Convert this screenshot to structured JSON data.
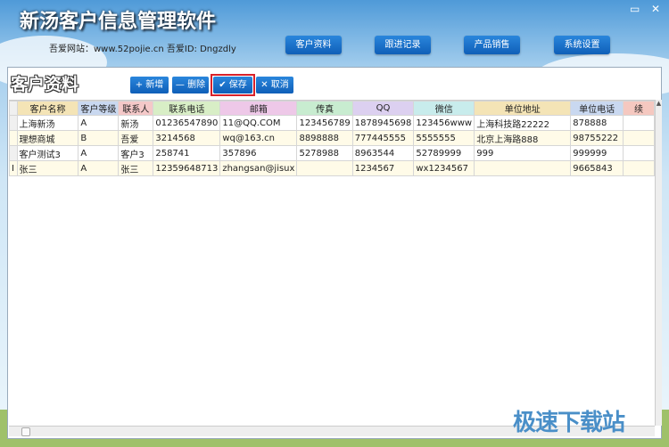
{
  "app": {
    "title": "新汤客户信息管理软件",
    "subtitle": "吾爱网站：www.52pojie.cn  吾爱ID: Dngzdly"
  },
  "window": {
    "maximize": "▭",
    "close": "✕"
  },
  "nav": [
    {
      "label": "客户资料"
    },
    {
      "label": "跟进记录"
    },
    {
      "label": "产品销售"
    },
    {
      "label": "系统设置"
    }
  ],
  "panel": {
    "title": "客户资料"
  },
  "toolbar": {
    "add": "+ 新增",
    "delete": "— 删除",
    "save": "✔ 保存",
    "cancel": "✕ 取消"
  },
  "table": {
    "columns": [
      {
        "label": "客户名称",
        "color": "#f4e4b6"
      },
      {
        "label": "客户等级",
        "color": "#c9d8f0"
      },
      {
        "label": "联系人",
        "color": "#f4c8c8"
      },
      {
        "label": "联系电话",
        "color": "#d8eec6"
      },
      {
        "label": "邮箱",
        "color": "#eec8e8"
      },
      {
        "label": "传真",
        "color": "#c8ecd0"
      },
      {
        "label": "QQ",
        "color": "#dcd0f0"
      },
      {
        "label": "微信",
        "color": "#c8ecec"
      },
      {
        "label": "单位地址",
        "color": "#f4e4b6"
      },
      {
        "label": "单位电话",
        "color": "#c9d8f0"
      },
      {
        "label": "续",
        "color": "#f5c8c0"
      }
    ],
    "rows": [
      [
        "上海新汤",
        "A",
        "新汤",
        "01236547890",
        "11@QQ.COM",
        "123456789",
        "1878945698",
        "123456www",
        "上海科技路22222",
        "878888",
        ""
      ],
      [
        "理想商城",
        "B",
        "吾爱",
        "3214568",
        "wq@163.cn",
        "8898888",
        "777445555",
        "5555555",
        "北京上海路888",
        "98755222",
        ""
      ],
      [
        "客户测试3",
        "A",
        "客户3",
        "258741",
        "357896",
        "5278988",
        "8963544",
        "52789999",
        "999",
        "999999",
        ""
      ],
      [
        "张三",
        "A",
        "张三",
        "12359648713",
        "zhangsan@jisux",
        "",
        "1234567",
        "wx1234567",
        "",
        "9665843",
        ""
      ]
    ],
    "edit_row_marker": "I"
  },
  "watermark": "极速下载站"
}
